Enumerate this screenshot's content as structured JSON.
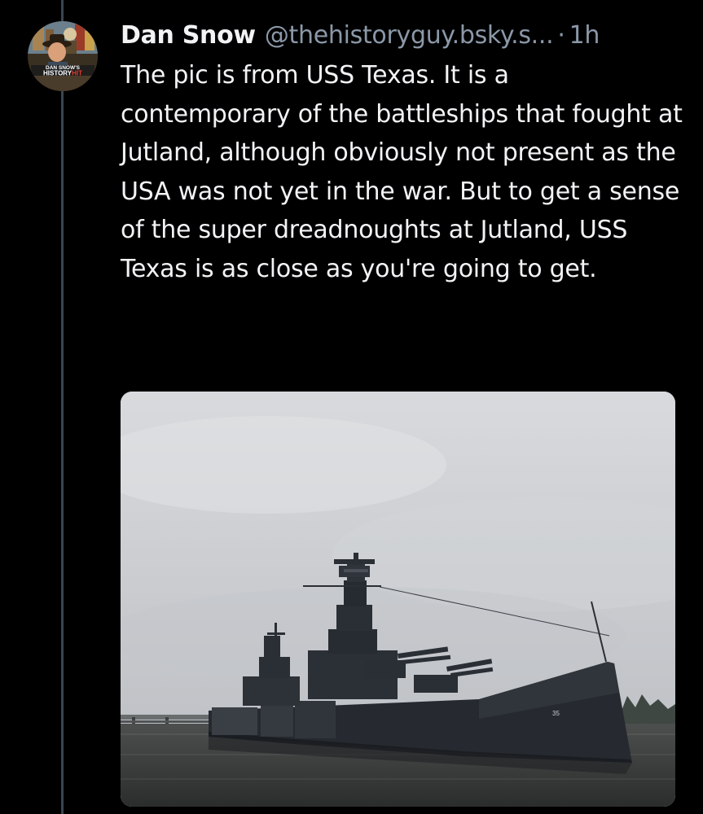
{
  "post": {
    "author_name": "Dan Snow",
    "author_handle": "@thehistoryguy.bsky.s...",
    "separator": "·",
    "timestamp": "1h",
    "text": "The pic is from USS Texas. It is a contemporary of the battleships that fought at Jutland, although obviously not present as the USA was not yet in the war. But to get a sense of the super dreadnoughts at Jutland, USS Texas is as close as you're going to get."
  },
  "avatar": {
    "line1": "DAN SNOW'S",
    "line2_a": "HISTORY",
    "line2_b": "HIT"
  },
  "media": {
    "hull_number": "35"
  },
  "colors": {
    "background": "#000000",
    "text_primary": "#f1f3f5",
    "text_secondary": "#8b98a8",
    "thread_line": "#3a4552"
  }
}
